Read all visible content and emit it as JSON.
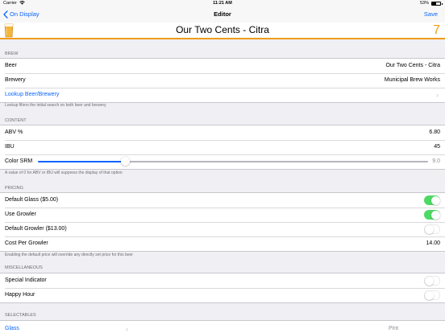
{
  "status_bar": {
    "carrier": "Carrier",
    "time": "11:21 AM",
    "battery": "53%",
    "battery_level": 0.53
  },
  "nav": {
    "back_label": "On Display",
    "title": "Editor",
    "save_label": "Save"
  },
  "header": {
    "beer_name": "Our Two Cents - Citra",
    "number": "7",
    "accent_color": "#ef9b1a"
  },
  "brew": {
    "section_title": "BREW",
    "beer_label": "Beer",
    "beer_value": "Our Two Cents - Citra",
    "brewery_label": "Brewery",
    "brewery_value": "Municipal Brew Works",
    "lookup_label": "Lookup Beer/Brewery",
    "footer": "Lookup filters the initial search on both beer and brewery"
  },
  "content": {
    "section_title": "CONTENT",
    "abv_label": "ABV %",
    "abv_value": "6.80",
    "ibu_label": "IBU",
    "ibu_value": "45",
    "srm_label": "Color SRM",
    "srm_value": "9.0",
    "srm_numeric": 9.0,
    "srm_max": 40,
    "footer": "A value of 0 for ABV or IBU will suppress the display of that option"
  },
  "pricing": {
    "section_title": "PRICING",
    "default_glass_label": "Default Glass ($5.00)",
    "default_glass_on": true,
    "use_growler_label": "Use Growler",
    "use_growler_on": true,
    "default_growler_label": "Default Growler ($13.00)",
    "default_growler_on": false,
    "cost_per_growler_label": "Cost Per Growler",
    "cost_per_growler_value": "14.00",
    "footer": "Enabling the default price will override any directly set price for this beer"
  },
  "misc": {
    "section_title": "MISCELLANEOUS",
    "special_indicator_label": "Special Indicator",
    "special_indicator_on": false,
    "happy_hour_label": "Happy Hour",
    "happy_hour_on": false
  },
  "selectables": {
    "section_title": "SELECTABLES",
    "glass_label": "Glass",
    "glass_value": "Pint"
  },
  "colors": {
    "tint": "#0a64ff",
    "toggle_on": "#4cd964",
    "accent": "#ef9b1a"
  }
}
